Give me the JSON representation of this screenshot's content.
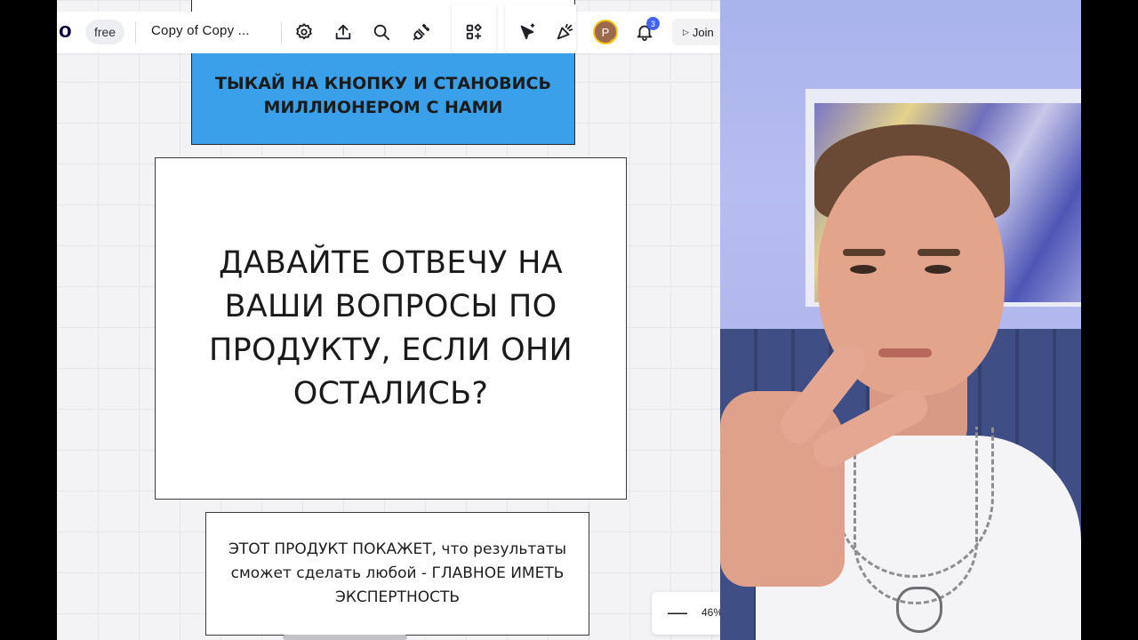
{
  "toolbar": {
    "logo_fragment": "o",
    "plan_badge": "free",
    "board_name": "Copy of Copy ...",
    "icons": [
      "settings-icon",
      "export-icon",
      "search-icon",
      "plugin-icon",
      "apps-icon",
      "cursor-select-icon",
      "celebrate-icon",
      "notification-bell-icon"
    ],
    "avatar_initial": "P",
    "notification_count": "3",
    "join_label": "Join"
  },
  "board": {
    "blue_card_text": "ТЫКАЙ НА КНОПКУ И СТАНОВИСЬ МИЛЛИОНЕРОМ С НАМИ",
    "question_card_text": "ДАВАЙТЕ ОТВЕЧУ НА ВАШИ ВОПРОСЫ ПО ПРОДУКТУ, ЕСЛИ ОНИ ОСТАЛИСЬ?",
    "info_card_text": "ЭТОТ ПРОДУКТ ПОКАЖЕТ, что результаты сможет сделать любой - ГЛАВНОЕ ИМЕТЬ ЭКСПЕРТНОСТЬ"
  },
  "zoom": {
    "minus_label": "—",
    "level": "46%"
  },
  "colors": {
    "blue_card": "#3aa0ea",
    "accent": "#4262ff",
    "avatar_ring": "#f5c518"
  }
}
